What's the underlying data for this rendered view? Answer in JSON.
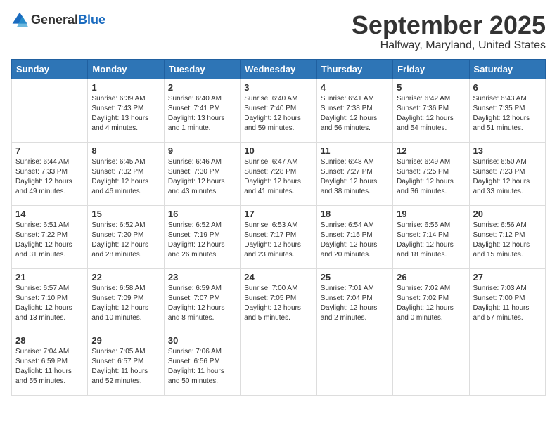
{
  "header": {
    "logo": {
      "general": "General",
      "blue": "Blue"
    },
    "title": "September 2025",
    "location": "Halfway, Maryland, United States"
  },
  "days_of_week": [
    "Sunday",
    "Monday",
    "Tuesday",
    "Wednesday",
    "Thursday",
    "Friday",
    "Saturday"
  ],
  "weeks": [
    [
      {
        "day": "",
        "info": ""
      },
      {
        "day": "1",
        "info": "Sunrise: 6:39 AM\nSunset: 7:43 PM\nDaylight: 13 hours\nand 4 minutes."
      },
      {
        "day": "2",
        "info": "Sunrise: 6:40 AM\nSunset: 7:41 PM\nDaylight: 13 hours\nand 1 minute."
      },
      {
        "day": "3",
        "info": "Sunrise: 6:40 AM\nSunset: 7:40 PM\nDaylight: 12 hours\nand 59 minutes."
      },
      {
        "day": "4",
        "info": "Sunrise: 6:41 AM\nSunset: 7:38 PM\nDaylight: 12 hours\nand 56 minutes."
      },
      {
        "day": "5",
        "info": "Sunrise: 6:42 AM\nSunset: 7:36 PM\nDaylight: 12 hours\nand 54 minutes."
      },
      {
        "day": "6",
        "info": "Sunrise: 6:43 AM\nSunset: 7:35 PM\nDaylight: 12 hours\nand 51 minutes."
      }
    ],
    [
      {
        "day": "7",
        "info": "Sunrise: 6:44 AM\nSunset: 7:33 PM\nDaylight: 12 hours\nand 49 minutes."
      },
      {
        "day": "8",
        "info": "Sunrise: 6:45 AM\nSunset: 7:32 PM\nDaylight: 12 hours\nand 46 minutes."
      },
      {
        "day": "9",
        "info": "Sunrise: 6:46 AM\nSunset: 7:30 PM\nDaylight: 12 hours\nand 43 minutes."
      },
      {
        "day": "10",
        "info": "Sunrise: 6:47 AM\nSunset: 7:28 PM\nDaylight: 12 hours\nand 41 minutes."
      },
      {
        "day": "11",
        "info": "Sunrise: 6:48 AM\nSunset: 7:27 PM\nDaylight: 12 hours\nand 38 minutes."
      },
      {
        "day": "12",
        "info": "Sunrise: 6:49 AM\nSunset: 7:25 PM\nDaylight: 12 hours\nand 36 minutes."
      },
      {
        "day": "13",
        "info": "Sunrise: 6:50 AM\nSunset: 7:23 PM\nDaylight: 12 hours\nand 33 minutes."
      }
    ],
    [
      {
        "day": "14",
        "info": "Sunrise: 6:51 AM\nSunset: 7:22 PM\nDaylight: 12 hours\nand 31 minutes."
      },
      {
        "day": "15",
        "info": "Sunrise: 6:52 AM\nSunset: 7:20 PM\nDaylight: 12 hours\nand 28 minutes."
      },
      {
        "day": "16",
        "info": "Sunrise: 6:52 AM\nSunset: 7:19 PM\nDaylight: 12 hours\nand 26 minutes."
      },
      {
        "day": "17",
        "info": "Sunrise: 6:53 AM\nSunset: 7:17 PM\nDaylight: 12 hours\nand 23 minutes."
      },
      {
        "day": "18",
        "info": "Sunrise: 6:54 AM\nSunset: 7:15 PM\nDaylight: 12 hours\nand 20 minutes."
      },
      {
        "day": "19",
        "info": "Sunrise: 6:55 AM\nSunset: 7:14 PM\nDaylight: 12 hours\nand 18 minutes."
      },
      {
        "day": "20",
        "info": "Sunrise: 6:56 AM\nSunset: 7:12 PM\nDaylight: 12 hours\nand 15 minutes."
      }
    ],
    [
      {
        "day": "21",
        "info": "Sunrise: 6:57 AM\nSunset: 7:10 PM\nDaylight: 12 hours\nand 13 minutes."
      },
      {
        "day": "22",
        "info": "Sunrise: 6:58 AM\nSunset: 7:09 PM\nDaylight: 12 hours\nand 10 minutes."
      },
      {
        "day": "23",
        "info": "Sunrise: 6:59 AM\nSunset: 7:07 PM\nDaylight: 12 hours\nand 8 minutes."
      },
      {
        "day": "24",
        "info": "Sunrise: 7:00 AM\nSunset: 7:05 PM\nDaylight: 12 hours\nand 5 minutes."
      },
      {
        "day": "25",
        "info": "Sunrise: 7:01 AM\nSunset: 7:04 PM\nDaylight: 12 hours\nand 2 minutes."
      },
      {
        "day": "26",
        "info": "Sunrise: 7:02 AM\nSunset: 7:02 PM\nDaylight: 12 hours\nand 0 minutes."
      },
      {
        "day": "27",
        "info": "Sunrise: 7:03 AM\nSunset: 7:00 PM\nDaylight: 11 hours\nand 57 minutes."
      }
    ],
    [
      {
        "day": "28",
        "info": "Sunrise: 7:04 AM\nSunset: 6:59 PM\nDaylight: 11 hours\nand 55 minutes."
      },
      {
        "day": "29",
        "info": "Sunrise: 7:05 AM\nSunset: 6:57 PM\nDaylight: 11 hours\nand 52 minutes."
      },
      {
        "day": "30",
        "info": "Sunrise: 7:06 AM\nSunset: 6:56 PM\nDaylight: 11 hours\nand 50 minutes."
      },
      {
        "day": "",
        "info": ""
      },
      {
        "day": "",
        "info": ""
      },
      {
        "day": "",
        "info": ""
      },
      {
        "day": "",
        "info": ""
      }
    ]
  ]
}
